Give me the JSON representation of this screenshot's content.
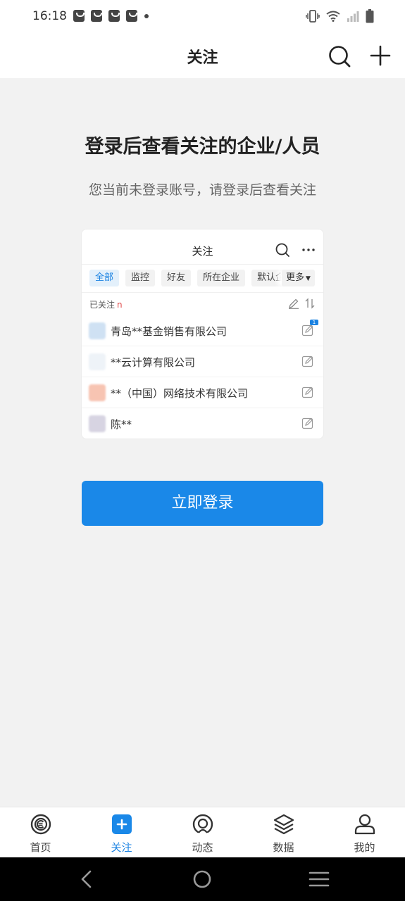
{
  "status_bar": {
    "time": "16:18"
  },
  "header": {
    "title": "关注"
  },
  "main": {
    "title": "登录后查看关注的企业/人员",
    "subtitle": "您当前未登录账号，请登录后查看关注",
    "login_button": "立即登录"
  },
  "preview": {
    "title": "关注",
    "tabs": [
      {
        "label": "全部",
        "active": true
      },
      {
        "label": "监控",
        "active": false
      },
      {
        "label": "好友",
        "active": false
      },
      {
        "label": "所在企业",
        "active": false
      },
      {
        "label": "默认企",
        "active": false
      }
    ],
    "more_label": "更多",
    "followed_label": "已关注",
    "followed_count": "n",
    "rows": [
      {
        "name": "青岛**基金销售有限公司",
        "logo_color": "#cfe1f3",
        "badge": "1"
      },
      {
        "name": "**云计算有限公司",
        "logo_color": "#eef3f8",
        "badge": ""
      },
      {
        "name": "**（中国）网络技术有限公司",
        "logo_color": "#f7c4b2",
        "badge": ""
      },
      {
        "name": "陈**",
        "logo_color": "#d7d4e2",
        "badge": ""
      }
    ]
  },
  "bottom_nav": {
    "items": [
      {
        "label": "首页",
        "icon": "home-c-icon",
        "active": false
      },
      {
        "label": "关注",
        "icon": "plus-square-icon",
        "active": true
      },
      {
        "label": "动态",
        "icon": "radar-icon",
        "active": false
      },
      {
        "label": "数据",
        "icon": "layers-icon",
        "active": false
      },
      {
        "label": "我的",
        "icon": "user-icon",
        "active": false
      }
    ]
  },
  "colors": {
    "accent": "#1a88e8",
    "background": "#f2f2f2"
  }
}
